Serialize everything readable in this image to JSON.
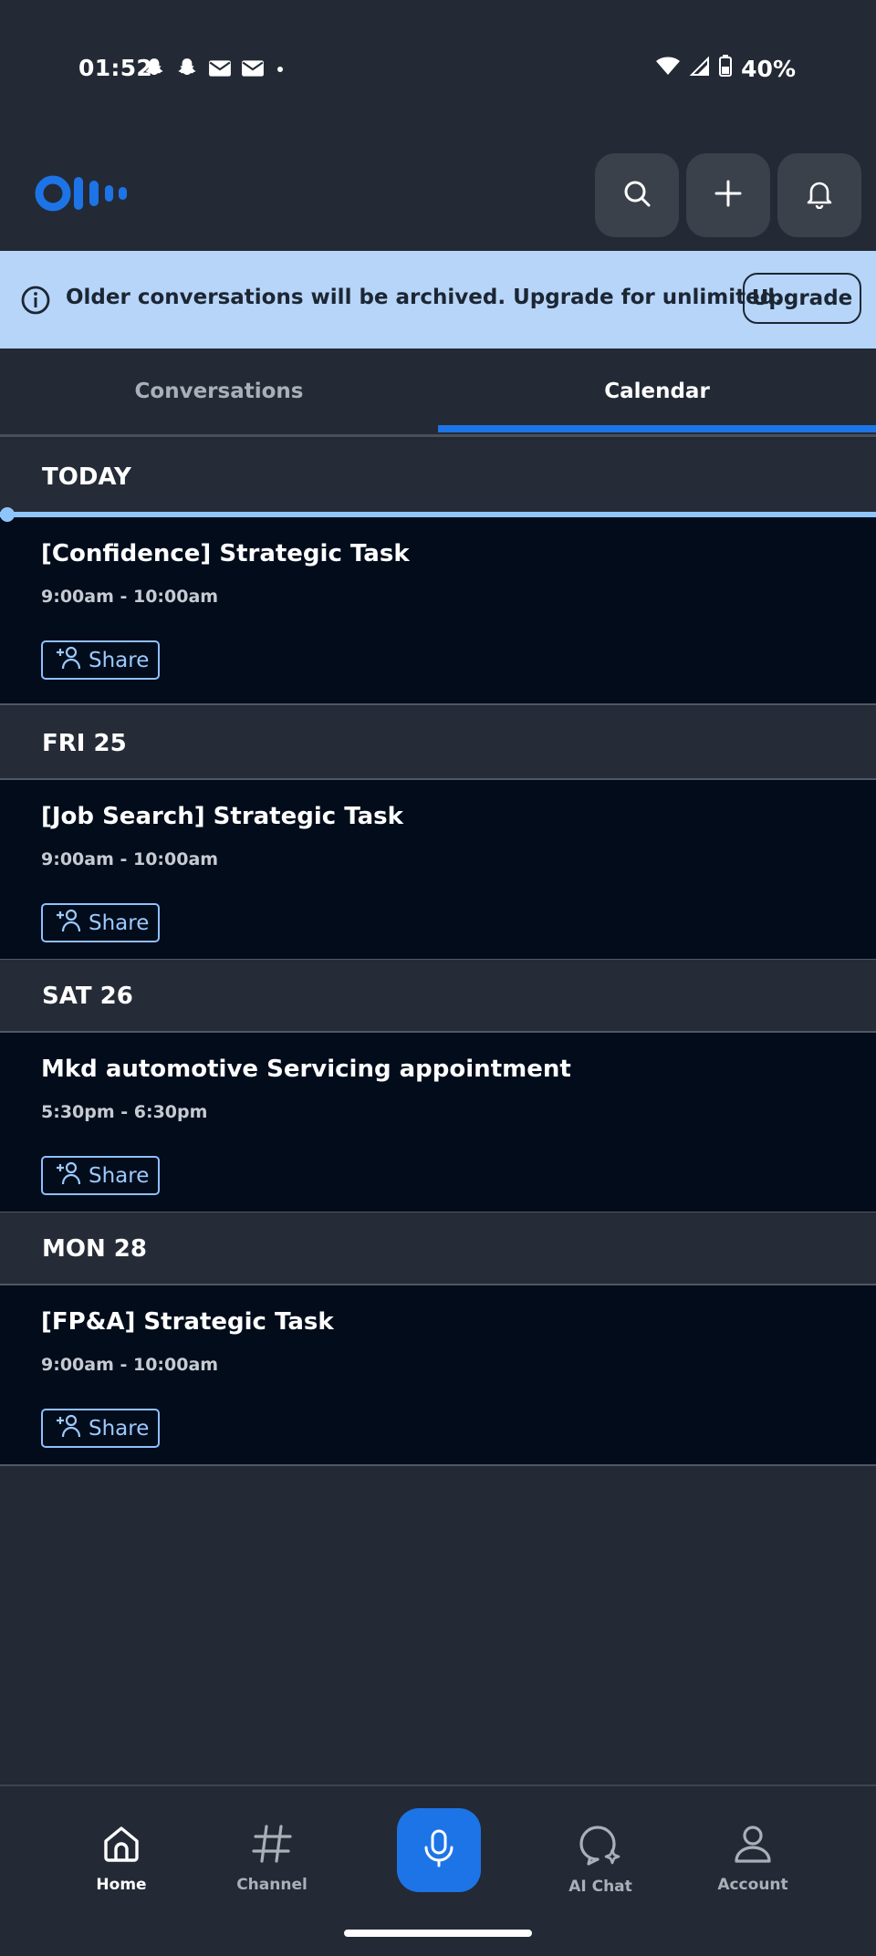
{
  "status_bar": {
    "time": "01:52",
    "battery": "40%",
    "left_icons": [
      "snapchat-icon",
      "snapchat-icon",
      "gmail-icon",
      "gmail-icon",
      "dot-icon"
    ],
    "right_icons": [
      "wifi-icon",
      "signal-icon",
      "battery-icon"
    ]
  },
  "header": {
    "logo": "otter-logo",
    "buttons": [
      "search-icon",
      "plus-icon",
      "bell-icon"
    ]
  },
  "banner": {
    "text": "Older conversations will be archived. Upgrade for unlimited.",
    "button_label": "Upgrade",
    "bg_color": "#b7d5f9"
  },
  "tabs": [
    {
      "label": "Conversations",
      "active": false
    },
    {
      "label": "Calendar",
      "active": true
    }
  ],
  "calendar": {
    "groups": [
      {
        "date_label": "TODAY",
        "events": [
          {
            "title": "[Confidence] Strategic Task",
            "time": "9:00am - 10:00am",
            "share_label": "Share"
          }
        ]
      },
      {
        "date_label": "FRI 25",
        "events": [
          {
            "title": "[Job Search] Strategic Task",
            "time": "9:00am - 10:00am",
            "share_label": "Share"
          }
        ]
      },
      {
        "date_label": "SAT 26",
        "events": [
          {
            "title": "Mkd automotive Servicing appointment",
            "time": "5:30pm - 6:30pm",
            "share_label": "Share"
          }
        ]
      },
      {
        "date_label": "MON 28",
        "events": [
          {
            "title": "[FP&A] Strategic Task",
            "time": "9:00am - 10:00am",
            "share_label": "Share"
          }
        ]
      }
    ]
  },
  "bottom_nav": {
    "items": [
      {
        "label": "Home",
        "icon": "home-icon",
        "active": true
      },
      {
        "label": "Channel",
        "icon": "hashtag-icon",
        "active": false
      },
      {
        "label": "",
        "icon": "microphone-icon",
        "active": false
      },
      {
        "label": "AI Chat",
        "icon": "ai-chat-icon",
        "active": false
      },
      {
        "label": "Account",
        "icon": "person-icon",
        "active": false
      }
    ]
  },
  "colors": {
    "background": "#232a35",
    "accent": "#1d74e6",
    "event_bg": "#020c1b",
    "share_border": "#8fc0ff"
  }
}
